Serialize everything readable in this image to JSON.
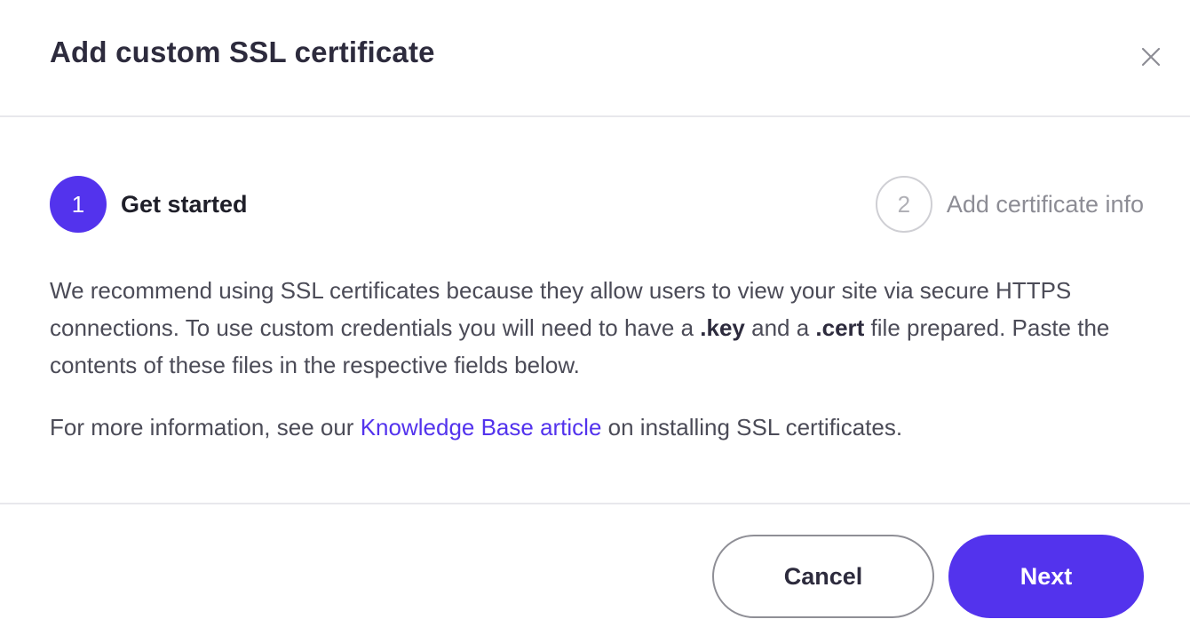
{
  "dialog": {
    "title": "Add custom SSL certificate"
  },
  "steps": [
    {
      "number": "1",
      "label": "Get started",
      "state": "active"
    },
    {
      "number": "2",
      "label": "Add certificate info",
      "state": "inactive"
    }
  ],
  "description": {
    "part1": "We recommend using SSL certificates because they allow users to view your site via secure HTTPS connections. To use custom credentials you will need to have a ",
    "key_ext": ".key",
    "part2": " and a ",
    "cert_ext": ".cert",
    "part3": " file prepared. Paste the contents of these files in the respective fields below."
  },
  "more_info": {
    "prefix": "For more information, see our ",
    "link_text": "Knowledge Base article",
    "suffix": " on installing SSL certificates."
  },
  "buttons": {
    "cancel": "Cancel",
    "next": "Next"
  },
  "icons": {
    "close": "close-icon"
  },
  "colors": {
    "accent": "#5333ed",
    "text": "#4b4b57",
    "divider": "#e8e8ec"
  }
}
